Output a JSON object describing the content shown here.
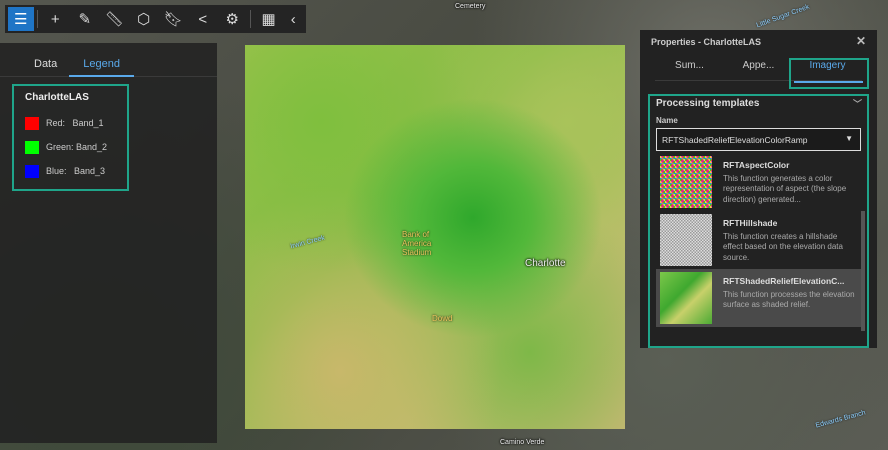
{
  "toolbar": {
    "items": [
      {
        "icon": "list-icon",
        "active": true
      },
      {
        "icon": "plus-icon"
      },
      {
        "icon": "pencil-icon"
      },
      {
        "icon": "ruler-icon"
      },
      {
        "icon": "cube-search-icon"
      },
      {
        "icon": "bookmark-icon"
      },
      {
        "icon": "share-icon"
      },
      {
        "icon": "gear-icon"
      },
      {
        "icon": "grid-icon"
      },
      {
        "icon": "chevron-left-icon"
      }
    ]
  },
  "left_panel": {
    "tabs": [
      {
        "label": "Data"
      },
      {
        "label": "Legend",
        "active": true
      }
    ],
    "legend": {
      "title": "CharlotteLAS",
      "items": [
        {
          "label": "Red:   Band_1",
          "color": "#ff0000"
        },
        {
          "label": "Green: Band_2",
          "color": "#00ff00"
        },
        {
          "label": "Blue:   Band_3",
          "color": "#0000ff"
        }
      ]
    }
  },
  "map": {
    "labels": {
      "stadium": "Bank of America Stadium",
      "city": "Charlotte",
      "dowd": "Dowd",
      "cemetery": "Cemetery",
      "creek1": "Little Sugar Creek",
      "creek2": "Irwin Creek",
      "branch": "Edwards Branch",
      "camino": "Camino Verde"
    }
  },
  "properties": {
    "title": "Properties - CharlotteLAS",
    "tabs": [
      {
        "label": "Sum..."
      },
      {
        "label": "Appe..."
      },
      {
        "label": "Imagery",
        "active": true
      }
    ],
    "section_title": "Processing templates",
    "name_label": "Name",
    "selected": "RFTShadedReliefElevationColorRamp",
    "templates": [
      {
        "name": "RFTAspectColor",
        "desc": "This function generates a color representation of aspect (the slope direction) generated..."
      },
      {
        "name": "RFTHillshade",
        "desc": "This function creates a hillshade effect based on the elevation data source."
      },
      {
        "name": "RFTShadedReliefElevationC...",
        "desc": "This function processes the elevation surface as shaded relief.",
        "selected": true
      }
    ]
  },
  "colors": {
    "accent": "#5aa9ea",
    "highlight": "#1fa58a",
    "active_tool": "#1f75c6"
  }
}
